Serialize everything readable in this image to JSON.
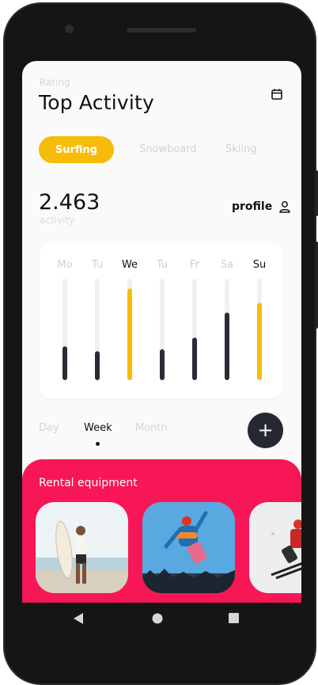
{
  "header": {
    "subtitle": "Rating",
    "title": "Top Activity"
  },
  "icons": {
    "calendar": "calendar-icon",
    "profile": "user-icon",
    "add": "plus-icon"
  },
  "tabs": [
    {
      "label": "Surfing",
      "active": true
    },
    {
      "label": "Snowboard",
      "active": false
    },
    {
      "label": "Skiing",
      "active": false
    }
  ],
  "stat": {
    "value": "2.463",
    "label": "activity"
  },
  "profile": {
    "label": "profile"
  },
  "chart_data": {
    "type": "bar",
    "categories": [
      "Mo",
      "Tu",
      "We",
      "Tu",
      "Fr",
      "Sa",
      "Su"
    ],
    "values": [
      30,
      25,
      90,
      27,
      39,
      65,
      75
    ],
    "highlighted": [
      "We",
      "Su"
    ],
    "active_labels": [
      "We",
      "Su"
    ],
    "ylim": [
      0,
      100
    ],
    "colors": {
      "normal": "#2a2c35",
      "highlight": "#f7bb0a",
      "track": "#f0f0f0"
    }
  },
  "periods": [
    {
      "label": "Day",
      "active": false
    },
    {
      "label": "Week",
      "active": true
    },
    {
      "label": "Month",
      "active": false
    }
  ],
  "fab": {
    "label": "+"
  },
  "rental": {
    "title": "Rental equipment",
    "items": [
      {
        "name": "surfboard",
        "icon": "surfer-photo"
      },
      {
        "name": "snowboard",
        "icon": "snowboarder-photo"
      },
      {
        "name": "skis",
        "icon": "skier-photo"
      }
    ]
  },
  "colors": {
    "accent": "#f7bb0a",
    "rental_bg": "#f71656",
    "dark": "#262832"
  }
}
